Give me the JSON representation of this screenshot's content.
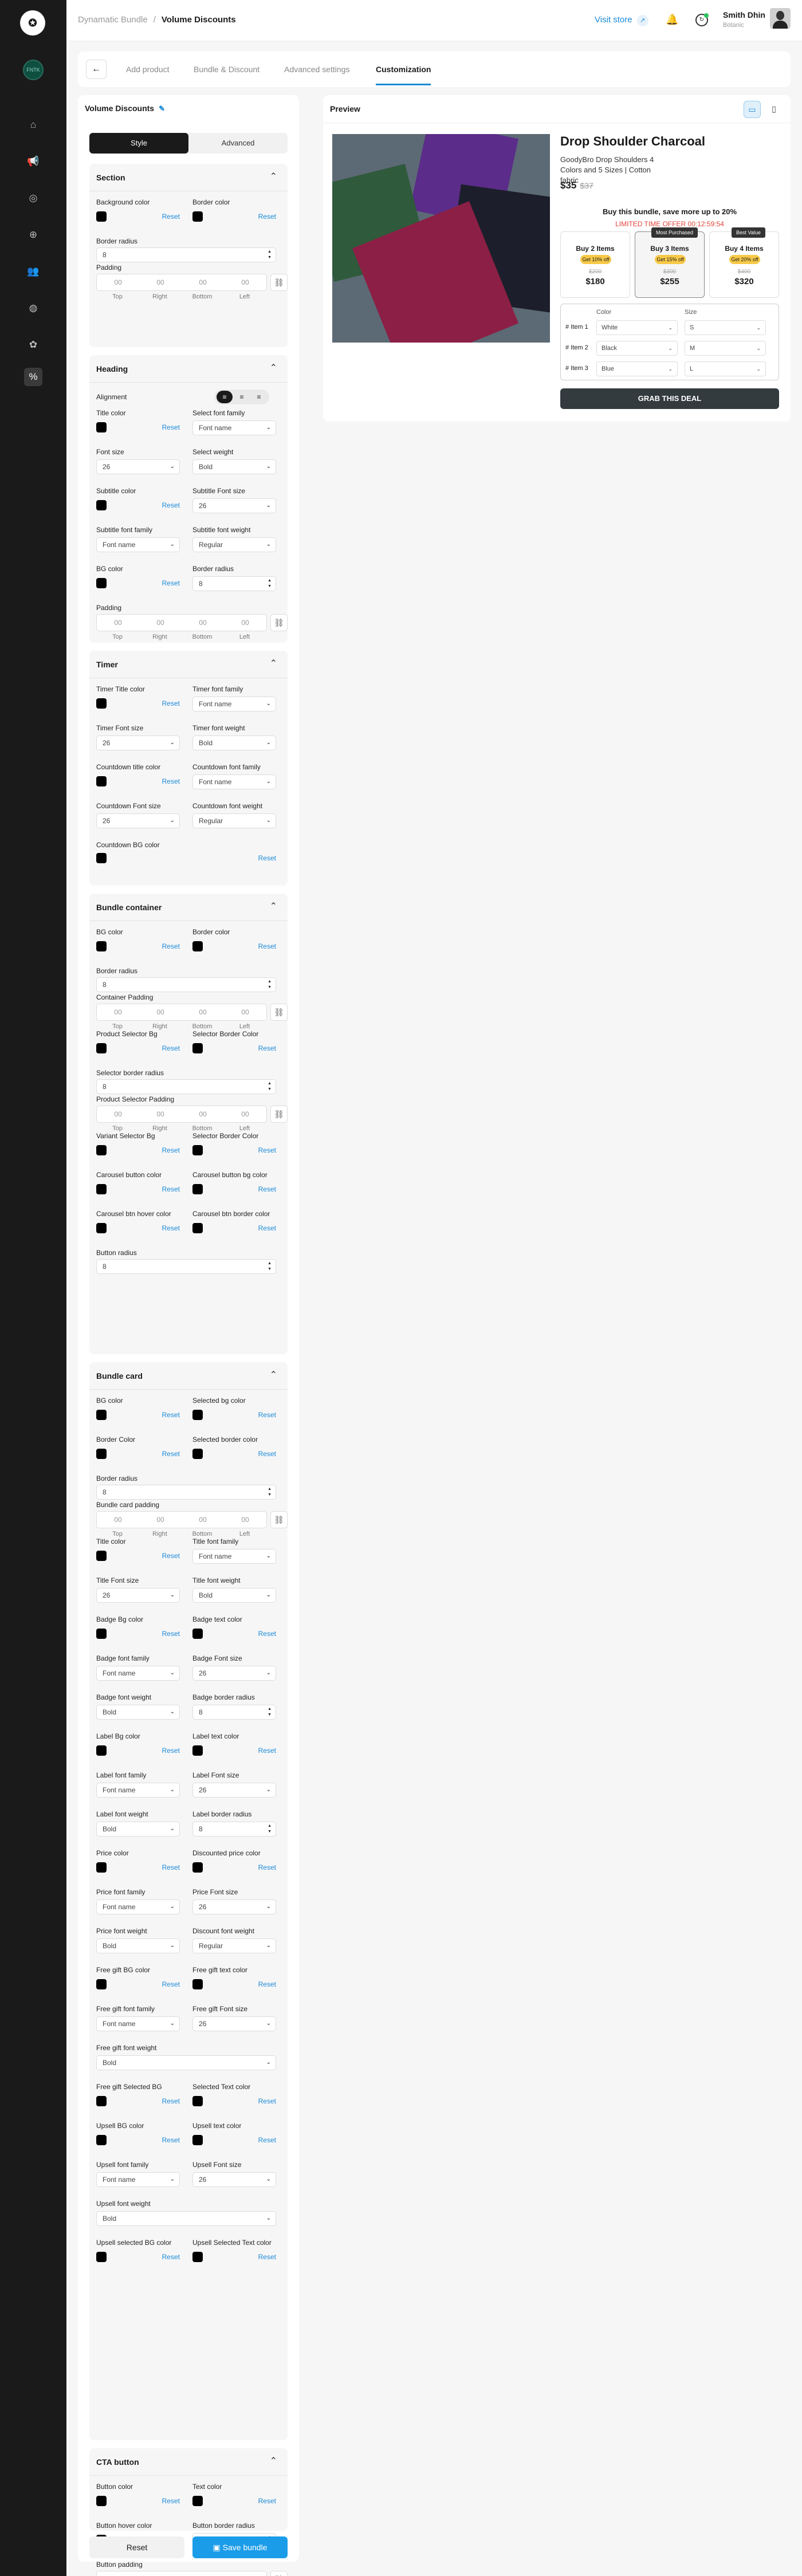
{
  "breadcrumb": {
    "parent": "Dynamatic Bundle",
    "current": "Volume Discounts"
  },
  "header": {
    "visit_store": "Visit store",
    "user_name": "Smith Dhin",
    "user_role": "Botanic"
  },
  "sidebar": {
    "store_badge": "FNTK",
    "nav_icons": [
      "home-icon",
      "megaphone-icon",
      "target-icon",
      "plus-circle-icon",
      "users-icon",
      "globe-icon",
      "badge-icon",
      "percent-icon"
    ],
    "active": "percent-icon"
  },
  "tabs": [
    "Add product",
    "Bundle & Discount",
    "Advanced settings",
    "Customization"
  ],
  "active_tab": "Customization",
  "panel": {
    "title": "Volume Discounts",
    "seg_style": "Style",
    "seg_advanced": "Advanced"
  },
  "common": {
    "reset": "Reset",
    "top": "Top",
    "right": "Right",
    "bottom": "Bottom",
    "left": "Left",
    "zero": "00"
  },
  "sections": [
    {
      "title": "Section",
      "rows": [
        {
          "type": "colors",
          "a": "Background color",
          "b": "Border color"
        },
        {
          "type": "number_full",
          "label": "Border radius",
          "value": "8"
        },
        {
          "type": "padding",
          "label": "Padding"
        }
      ]
    },
    {
      "title": "Heading",
      "rows": [
        {
          "type": "alignment",
          "label": "Alignment"
        },
        {
          "type": "colorsel",
          "a": "Title color",
          "b": "Select font family",
          "bval": "Font name"
        },
        {
          "type": "selsel",
          "a": "Font size",
          "aval": "26",
          "b": "Select weight",
          "bval": "Bold"
        },
        {
          "type": "colorsel",
          "a": "Subtitle color",
          "b": "Subtitle Font size",
          "bval": "26"
        },
        {
          "type": "selsel",
          "a": "Subtitle font family",
          "aval": "Font name",
          "b": "Subtitle font weight",
          "bval": "Regular"
        },
        {
          "type": "colornum",
          "a": "BG color",
          "b": "Border radius",
          "bval": "8"
        },
        {
          "type": "padding",
          "label": "Padding"
        }
      ]
    },
    {
      "title": "Timer",
      "rows": [
        {
          "type": "colorsel",
          "a": "Timer Title color",
          "b": "Timer font family",
          "bval": "Font name"
        },
        {
          "type": "selsel",
          "a": "Timer Font size",
          "aval": "26",
          "b": "Timer font weight",
          "bval": "Bold"
        },
        {
          "type": "colorsel",
          "a": "Countdown title color",
          "b": "Countdown font family",
          "bval": "Font name"
        },
        {
          "type": "selsel",
          "a": "Countdown Font size",
          "aval": "26",
          "b": "Countdown font weight",
          "bval": "Regular"
        },
        {
          "type": "colorwide",
          "a": "Countdown BG color"
        }
      ]
    },
    {
      "title": "Bundle container",
      "rows": [
        {
          "type": "colors",
          "a": "BG color",
          "b": "Border color"
        },
        {
          "type": "number_full",
          "label": "Border radius",
          "value": "8"
        },
        {
          "type": "padding",
          "label": "Container Padding"
        },
        {
          "type": "colors",
          "a": "Product Selector Bg",
          "b": "Selector Border Color"
        },
        {
          "type": "number_full",
          "label": "Selector border radius",
          "value": "8"
        },
        {
          "type": "padding",
          "label": "Product Selector Padding"
        },
        {
          "type": "colors",
          "a": "Variant Selector Bg",
          "b": "Selector Border Color"
        },
        {
          "type": "colors",
          "a": "Carousel button color",
          "b": "Carousel button bg color"
        },
        {
          "type": "colors",
          "a": "Carousel btn hover color",
          "b": "Carousel btn border color"
        },
        {
          "type": "number_full",
          "label": "Button radius",
          "value": "8"
        }
      ]
    },
    {
      "title": "Bundle card",
      "rows": [
        {
          "type": "colors",
          "a": "BG color",
          "b": "Selected bg color"
        },
        {
          "type": "colors",
          "a": "Border Color",
          "b": "Selected border color"
        },
        {
          "type": "number_full",
          "label": "Border radius",
          "value": "8"
        },
        {
          "type": "padding",
          "label": "Bundle card padding"
        },
        {
          "type": "colorsel",
          "a": "Title color",
          "b": "Title font family",
          "bval": "Font name"
        },
        {
          "type": "selsel",
          "a": "Title Font size",
          "aval": "26",
          "b": "Title font weight",
          "bval": "Bold"
        },
        {
          "type": "colors",
          "a": "Badge Bg color",
          "b": "Badge text color"
        },
        {
          "type": "selsel",
          "a": "Badge font family",
          "aval": "Font name",
          "b": "Badge Font size",
          "bval": "26"
        },
        {
          "type": "selnum",
          "a": "Badge font weight",
          "aval": "Bold",
          "b": "Badge border radius",
          "bval": "8"
        },
        {
          "type": "colors",
          "a": "Label Bg color",
          "b": "Label text color"
        },
        {
          "type": "selsel",
          "a": "Label font family",
          "aval": "Font name",
          "b": "Label Font size",
          "bval": "26"
        },
        {
          "type": "selnum",
          "a": "Label font weight",
          "aval": "Bold",
          "b": "Label border radius",
          "bval": "8"
        },
        {
          "type": "colors",
          "a": "Price color",
          "b": "Discounted price color"
        },
        {
          "type": "selsel",
          "a": "Price font family",
          "aval": "Font name",
          "b": "Price Font size",
          "bval": "26"
        },
        {
          "type": "selsel",
          "a": "Price font weight",
          "aval": "Bold",
          "b": "Discount font weight",
          "bval": "Regular"
        },
        {
          "type": "colors",
          "a": "Free gift BG color",
          "b": "Free gift text color"
        },
        {
          "type": "selsel",
          "a": "Free gift font family",
          "aval": "Font name",
          "b": "Free gift Font size",
          "bval": "26"
        },
        {
          "type": "sel_full",
          "label": "Free gift font weight",
          "value": "Bold"
        },
        {
          "type": "colors",
          "a": "Free gift Selected BG",
          "b": "Selected Text color"
        },
        {
          "type": "colors",
          "a": "Upsell BG color",
          "b": "Upsell text color"
        },
        {
          "type": "selsel",
          "a": "Upsell font family",
          "aval": "Font name",
          "b": "Upsell Font size",
          "bval": "26"
        },
        {
          "type": "sel_full",
          "label": "Upsell font weight",
          "value": "Bold"
        },
        {
          "type": "colors",
          "a": "Upsell selected BG color",
          "b": "Upsell Selected Text color"
        }
      ]
    },
    {
      "title": "CTA button",
      "rows": [
        {
          "type": "colors",
          "a": "Button color",
          "b": "Text color"
        },
        {
          "type": "colornum",
          "a": "Button hover color",
          "b": "Button border radius",
          "bval": "8"
        },
        {
          "type": "padding",
          "label": "Button padding"
        }
      ]
    }
  ],
  "footer": {
    "reset": "Reset",
    "save": "Save bundle"
  },
  "preview": {
    "title": "Preview",
    "product_title": "Drop Shoulder Charcoal",
    "description": "GoodyBro Drop Shoulders 4 Colors and 5 Sizes | Cotton fabric",
    "price": "$35",
    "old_price": "$37",
    "save_note": "Buy this bundle, save more up to 20%",
    "timer": "LIMITED TIME OFFER 00:12:59:54",
    "cards": [
      {
        "title": "Buy 2 Items",
        "badge": "Get 10% off",
        "old": "$200",
        "price": "$180",
        "label": ""
      },
      {
        "title": "Buy 3 Items",
        "badge": "Get 15% off",
        "old": "$300",
        "price": "$255",
        "label": "Most Purchased"
      },
      {
        "title": "Buy 4 Items",
        "badge": "Get 20% off",
        "old": "$400",
        "price": "$320",
        "label": "Best Value"
      }
    ],
    "variant_headers": {
      "color": "Color",
      "size": "Size"
    },
    "variants": [
      {
        "item": "# Item 1",
        "color": "White",
        "size": "S"
      },
      {
        "item": "# Item 2",
        "color": "Black",
        "size": "M"
      },
      {
        "item": "# Item 3",
        "color": "Blue",
        "size": "L"
      }
    ],
    "cta": "GRAB THIS DEAL"
  },
  "colors": {
    "accent": "#1b8ad6",
    "dark": "#1a1a1a",
    "timer": "#e0443a",
    "badge": "#f7c948"
  }
}
